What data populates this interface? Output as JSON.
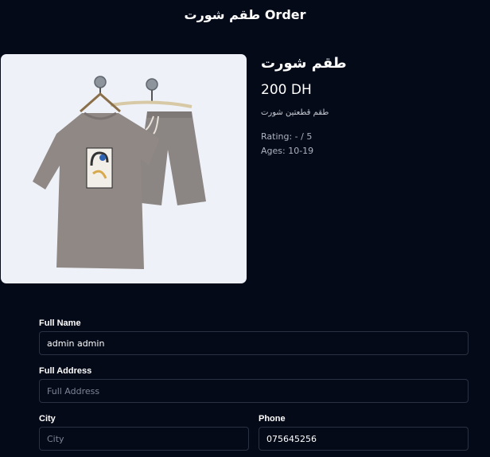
{
  "page": {
    "title": "طقم شورت Order"
  },
  "product": {
    "name": "طقم شورت",
    "price": "200 DH",
    "description": "طقم قطعتين شورت",
    "rating": "Rating: - / 5",
    "ages": "Ages: 10-19",
    "image_icon": "outfit-photo"
  },
  "form": {
    "full_name": {
      "label": "Full Name",
      "value": "admin admin",
      "placeholder": ""
    },
    "full_address": {
      "label": "Full Address",
      "value": "",
      "placeholder": "Full Address"
    },
    "city": {
      "label": "City",
      "value": "",
      "placeholder": "City"
    },
    "phone": {
      "label": "Phone",
      "value": "075645256",
      "placeholder": ""
    }
  },
  "colors": {
    "background": "#050a19",
    "field_border": "#2a3142",
    "image_background": "#eef2f8",
    "garment": "#8f8885"
  }
}
